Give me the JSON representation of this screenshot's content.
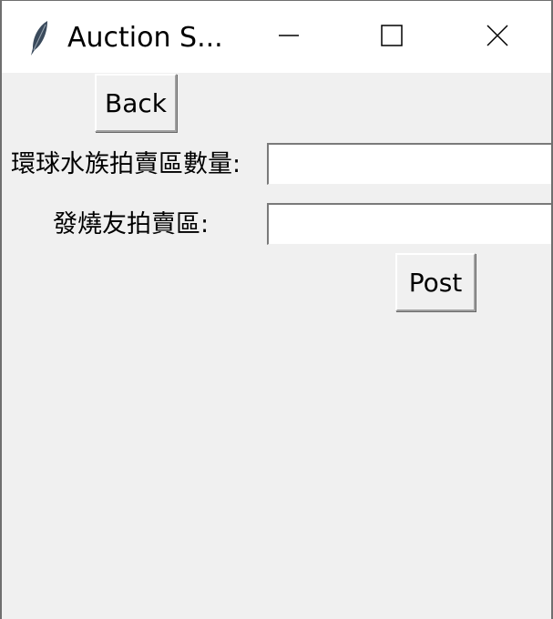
{
  "window": {
    "title": "Auction S..."
  },
  "icons": {
    "app": "feather-icon",
    "minimize": "minimize-icon",
    "maximize": "maximize-icon",
    "close": "close-icon"
  },
  "form": {
    "back_label": "Back",
    "quantity_label": "環球水族拍賣區數量:",
    "quantity_value": "",
    "second_label": "發燒友拍賣區:",
    "second_value": "",
    "post_label": "Post"
  }
}
